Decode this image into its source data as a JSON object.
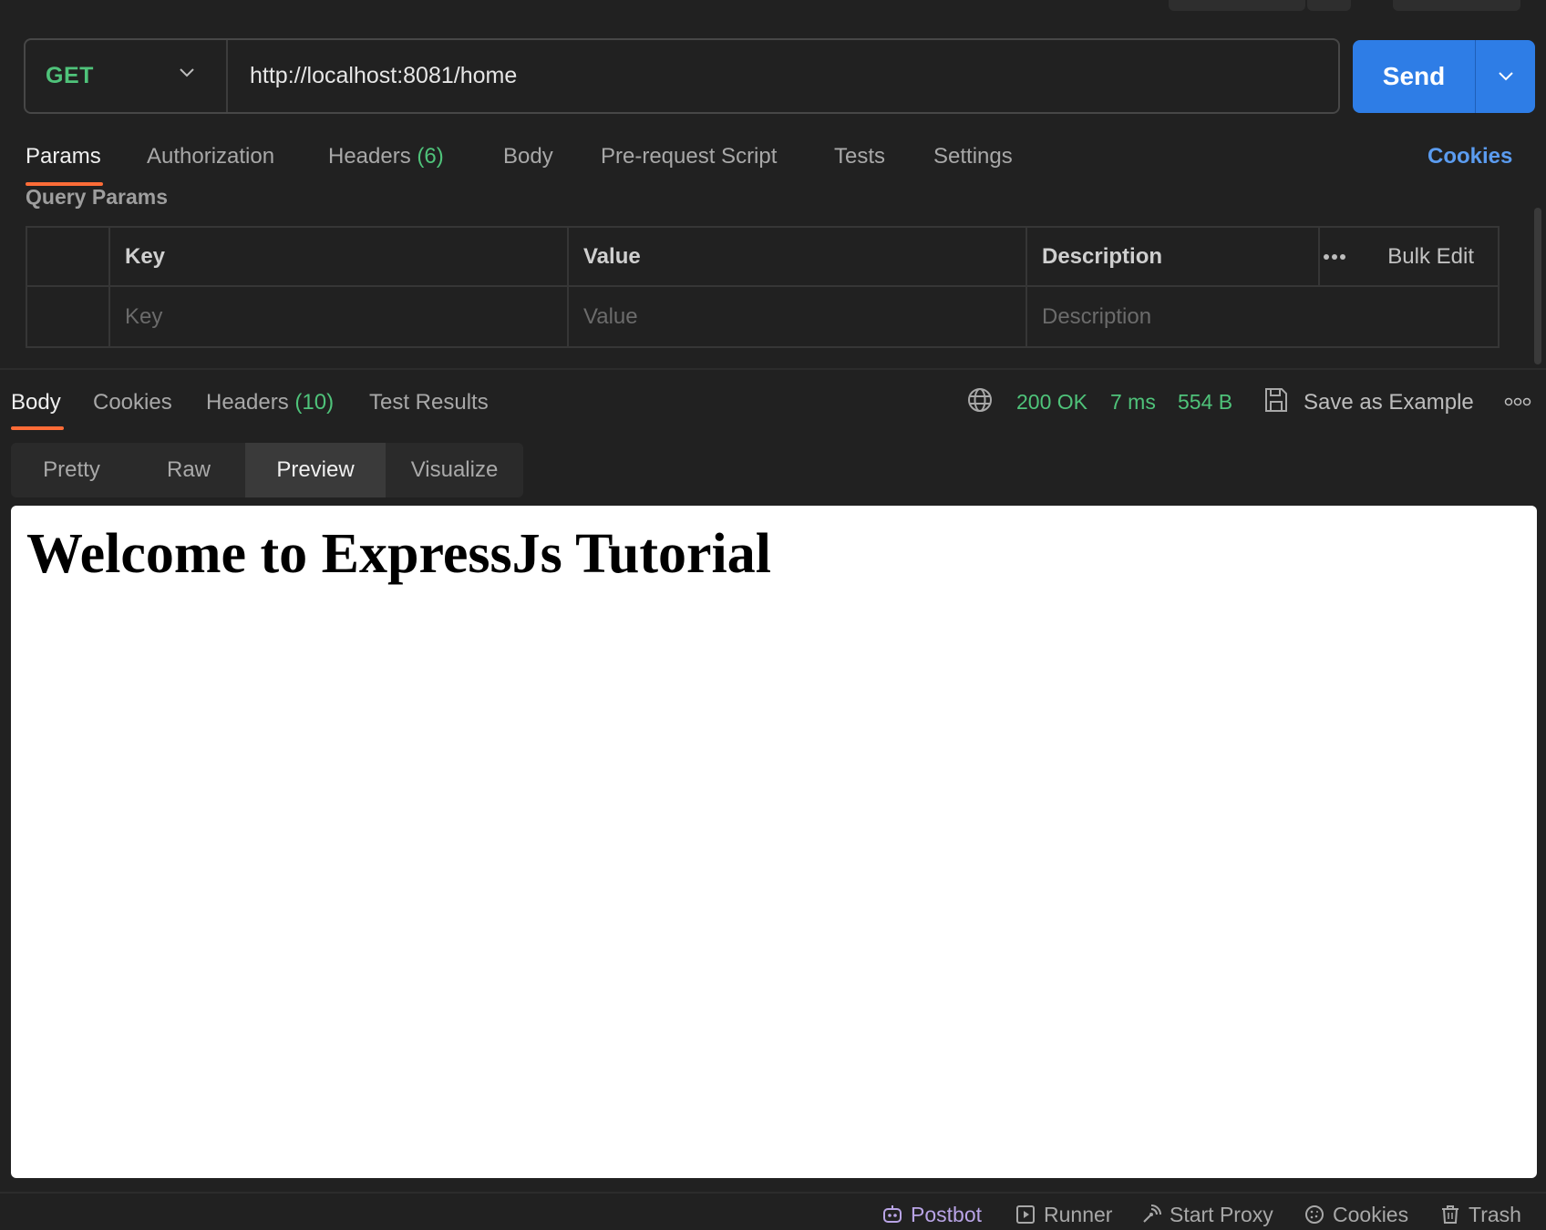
{
  "request": {
    "method": "GET",
    "url": "http://localhost:8081/home",
    "send_label": "Send"
  },
  "request_tabs": {
    "params": "Params",
    "authorization": "Authorization",
    "headers": "Headers",
    "headers_count": "(6)",
    "body": "Body",
    "pre_request": "Pre-request Script",
    "tests": "Tests",
    "settings": "Settings",
    "cookies": "Cookies"
  },
  "query_params": {
    "title": "Query Params",
    "columns": {
      "key": "Key",
      "value": "Value",
      "description": "Description"
    },
    "bulk_edit": "Bulk Edit",
    "placeholders": {
      "key": "Key",
      "value": "Value",
      "description": "Description"
    }
  },
  "response_tabs": {
    "body": "Body",
    "cookies": "Cookies",
    "headers": "Headers",
    "headers_count": "(10)",
    "test_results": "Test Results"
  },
  "response_status": {
    "status": "200 OK",
    "time": "7 ms",
    "size": "554 B",
    "save_example": "Save as Example"
  },
  "view_modes": {
    "pretty": "Pretty",
    "raw": "Raw",
    "preview": "Preview",
    "visualize": "Visualize"
  },
  "preview": {
    "heading": "Welcome to ExpressJs Tutorial"
  },
  "footer": {
    "postbot": "Postbot",
    "runner": "Runner",
    "start_proxy": "Start Proxy",
    "cookies": "Cookies",
    "trash": "Trash"
  },
  "colors": {
    "accent_orange": "#ff6c37",
    "send_blue": "#2e7de6",
    "success_green": "#4fc37a",
    "link_blue": "#5b9cf0"
  }
}
